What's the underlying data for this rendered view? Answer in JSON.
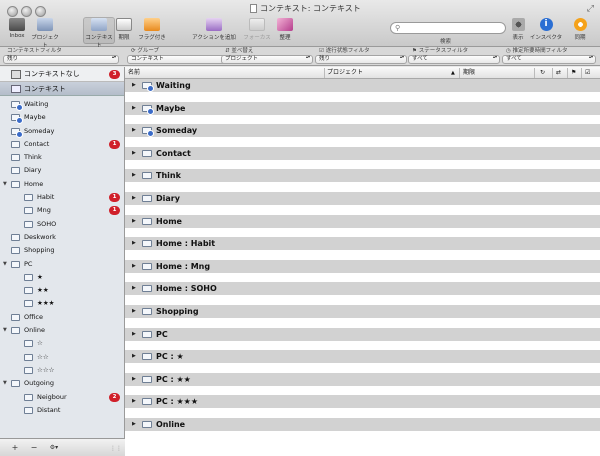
{
  "window": {
    "title": "コンテキスト: コンテキスト"
  },
  "toolbar": {
    "buttons": [
      {
        "label": "Inbox",
        "icon": "inbox-icon"
      },
      {
        "label": "プロジェクト",
        "icon": "projects-icon"
      },
      {
        "label": "コンテキスト",
        "icon": "contexts-icon"
      },
      {
        "label": "期限",
        "icon": "due-icon"
      },
      {
        "label": "フラグ付き",
        "icon": "flag-icon"
      },
      {
        "label": "アクションを追加",
        "icon": "add-action-icon"
      },
      {
        "label": "フォーカス",
        "icon": "focus-icon"
      },
      {
        "label": "整理",
        "icon": "clean-up-icon"
      },
      {
        "label": "表示",
        "icon": "view-icon"
      },
      {
        "label": "インスペクタ",
        "icon": "inspector-icon"
      },
      {
        "label": "同期",
        "icon": "sync-icon"
      }
    ],
    "search_label": "検索",
    "search_value": ""
  },
  "filters": [
    {
      "label": "コンテキストフィルタ",
      "value": "残り"
    },
    {
      "label": "グループ",
      "value": "コンテキスト"
    },
    {
      "label": "並べ替え",
      "value": "プロジェクト"
    },
    {
      "label": "遂行状態フィルタ",
      "value": "残り"
    },
    {
      "label": "ステータスフィルタ",
      "value": "すべて"
    },
    {
      "label": "推定所要時間フィルタ",
      "value": "すべて"
    }
  ],
  "sidebar": {
    "no_context": {
      "label": "コンテキストなし",
      "badge": "3"
    },
    "header": "コンテキスト",
    "items": [
      {
        "label": "Waiting",
        "badge": ""
      },
      {
        "label": "Maybe",
        "badge": ""
      },
      {
        "label": "Someday",
        "badge": ""
      },
      {
        "label": "Contact",
        "badge": "1"
      },
      {
        "label": "Think",
        "badge": ""
      },
      {
        "label": "Diary",
        "badge": ""
      },
      {
        "label": "Home",
        "badge": ""
      },
      {
        "label": "Habit",
        "badge": "1"
      },
      {
        "label": "Mng",
        "badge": "1"
      },
      {
        "label": "SOHO",
        "badge": ""
      },
      {
        "label": "Deskwork",
        "badge": ""
      },
      {
        "label": "Shopping",
        "badge": ""
      },
      {
        "label": "PC",
        "badge": ""
      },
      {
        "label": "★",
        "badge": ""
      },
      {
        "label": "★★",
        "badge": ""
      },
      {
        "label": "★★★",
        "badge": ""
      },
      {
        "label": "Office",
        "badge": ""
      },
      {
        "label": "Online",
        "badge": ""
      },
      {
        "label": "☆",
        "badge": ""
      },
      {
        "label": "☆☆",
        "badge": ""
      },
      {
        "label": "☆☆☆",
        "badge": ""
      },
      {
        "label": "Outgoing",
        "badge": ""
      },
      {
        "label": "Neigbour",
        "badge": "2"
      },
      {
        "label": "Distant",
        "badge": ""
      }
    ],
    "bottom": {
      "add": "+",
      "remove": "−",
      "gear": "⚙▾"
    }
  },
  "columns": {
    "name": "名前",
    "project": "プロジェクト",
    "due": "期限"
  },
  "rows": [
    "Waiting",
    "Maybe",
    "Someday",
    "Contact",
    "Think",
    "Diary",
    "Home",
    "Home : Habit",
    "Home : Mng",
    "Home : SOHO",
    "Shopping",
    "PC",
    "PC : ★",
    "PC : ★★",
    "PC : ★★★",
    "Online"
  ]
}
